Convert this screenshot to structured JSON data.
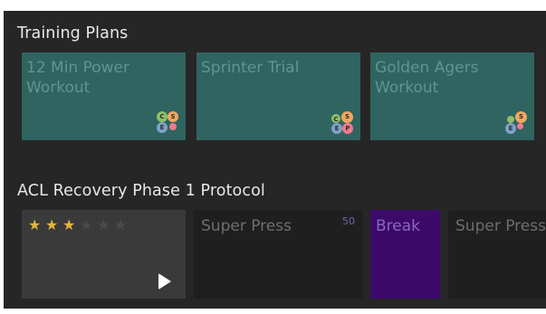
{
  "training_plans": {
    "title": "Training Plans",
    "plans": [
      {
        "name": "12 Min Power Workout",
        "badges": [
          "C",
          "S",
          "E",
          ""
        ]
      },
      {
        "name": "Sprinter Trial",
        "badges": [
          "C",
          "S",
          "E",
          "P"
        ]
      },
      {
        "name": "Golden Agers Workout",
        "badges": [
          "",
          "S",
          "E",
          ""
        ]
      }
    ]
  },
  "protocol": {
    "title": "ACL Recovery Phase 1 Protocol",
    "rating": 3,
    "rating_max": 5,
    "play_icon": "play-icon",
    "tiles": [
      {
        "label": "Super Press",
        "count": "50"
      },
      {
        "label": "Break"
      },
      {
        "label": "Super Press"
      }
    ]
  },
  "colors": {
    "background": "#262626",
    "plan_card": "#2f6460",
    "break_tile": "#3b0a6b",
    "star_filled": "#e2b53a",
    "star_empty": "#4a4a4a",
    "badge_c": "#8fbf6a",
    "badge_s": "#f0a860",
    "badge_e": "#7fa2c8",
    "badge_p": "#f07a8e"
  }
}
